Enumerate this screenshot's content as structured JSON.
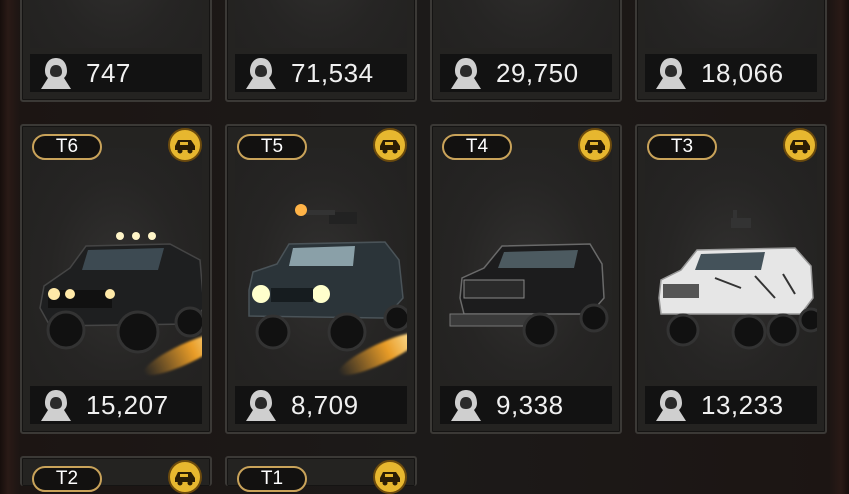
{
  "top_row": [
    {
      "count": "747"
    },
    {
      "count": "71,534"
    },
    {
      "count": "29,750"
    },
    {
      "count": "18,066"
    }
  ],
  "middle_row": [
    {
      "tier": "T6",
      "count": "15,207",
      "body_color": "#1d1e1f"
    },
    {
      "tier": "T5",
      "count": "8,709",
      "body_color": "#2a3236"
    },
    {
      "tier": "T4",
      "count": "9,338",
      "body_color": "#1b1b1c"
    },
    {
      "tier": "T3",
      "count": "13,233",
      "body_color": "#e6e6e6"
    }
  ],
  "bottom_row": [
    {
      "tier": "T2"
    },
    {
      "tier": "T1"
    }
  ],
  "colors": {
    "accent_gold": "#e7b72f",
    "tier_border": "#c9a35a"
  },
  "icons": {
    "type_badge": "armored-vehicle-icon",
    "count_icon": "hooded-soldier-icon"
  }
}
